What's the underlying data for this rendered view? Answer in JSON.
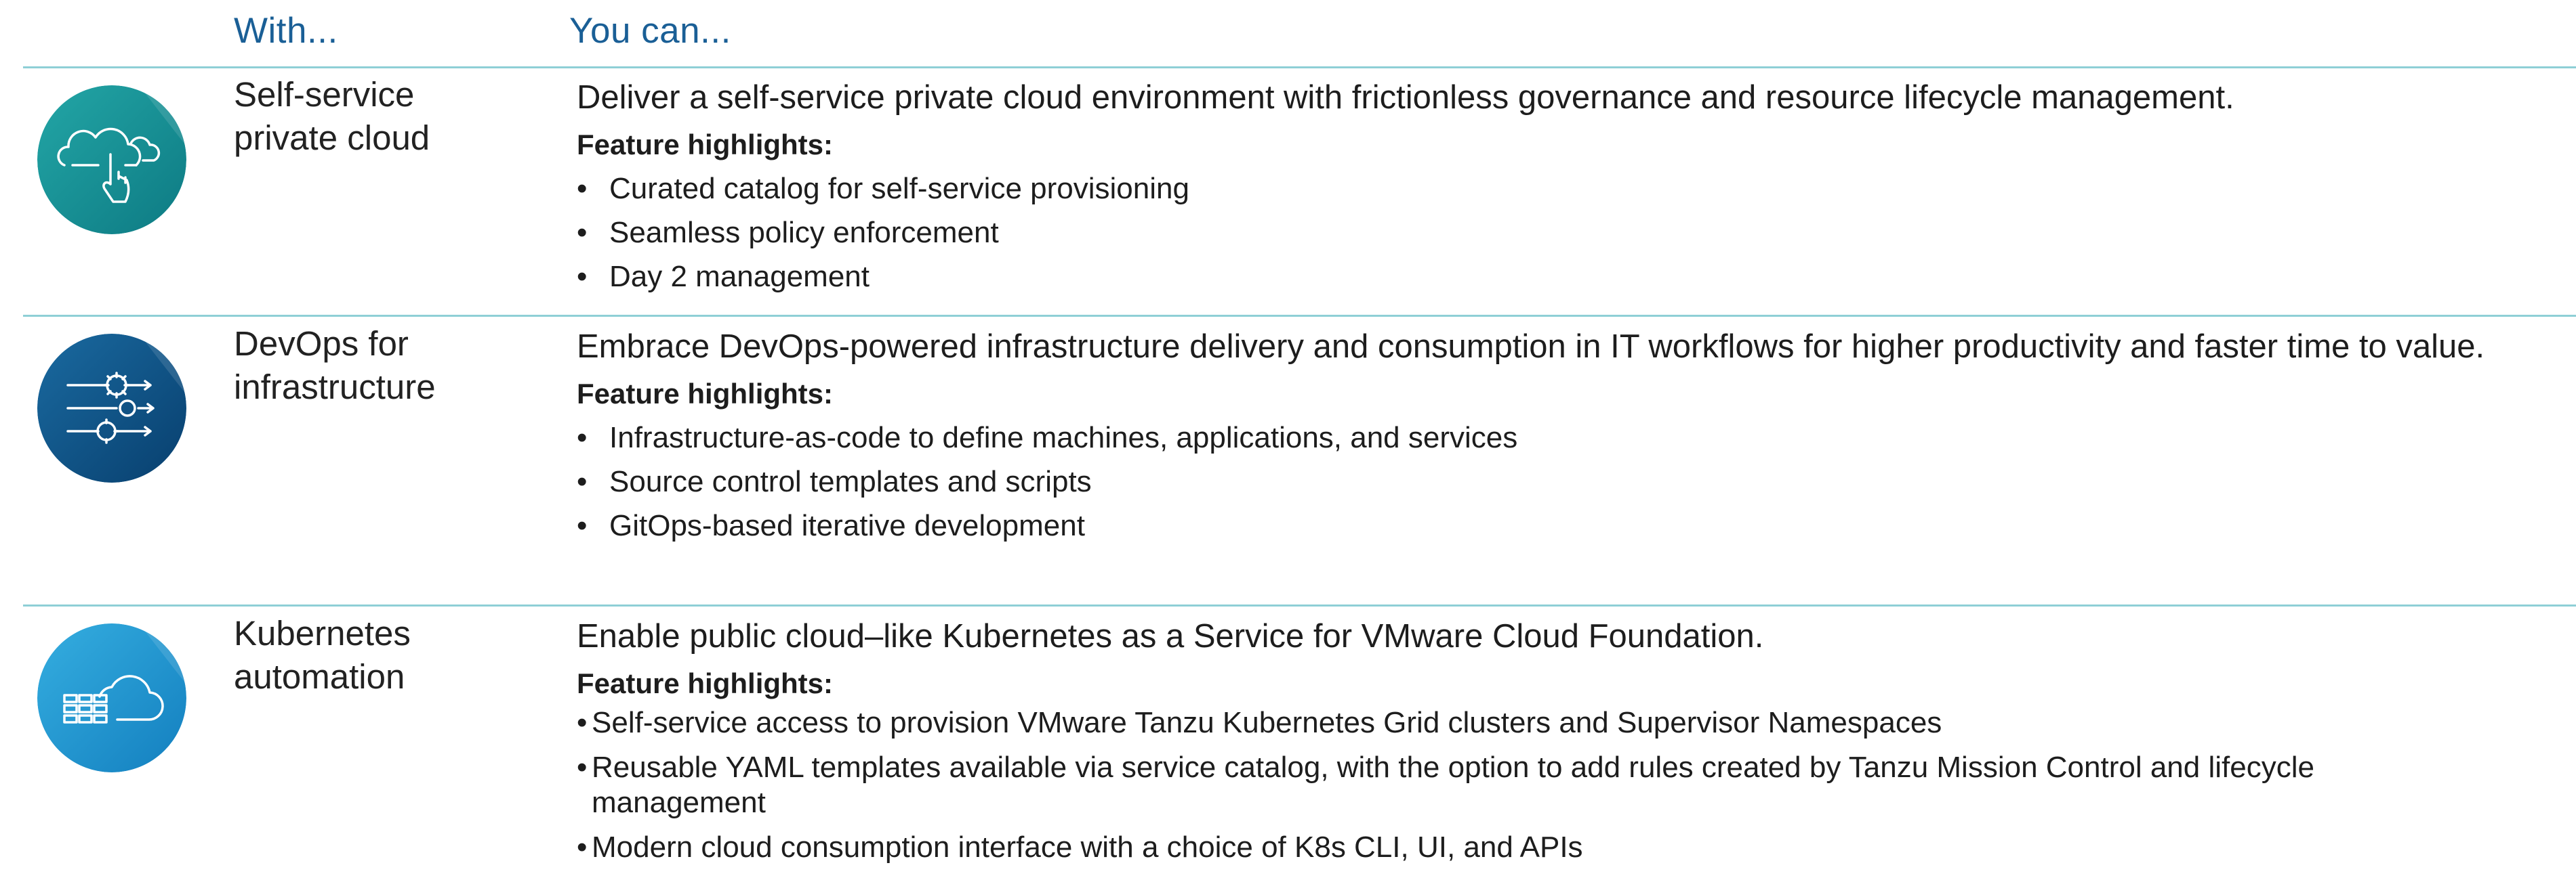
{
  "header": {
    "with_label": "With...",
    "can_label": "You can..."
  },
  "rows": [
    {
      "icon": "cloud-touch-icon",
      "with_line1": "Self-service",
      "with_line2": "private cloud",
      "description": "Deliver a self-service private cloud environment with frictionless governance and resource lifecycle management.",
      "highlights_label": "Feature highlights:",
      "bullets": [
        "Curated catalog for self-service provisioning",
        "Seamless policy enforcement",
        "Day 2 management"
      ]
    },
    {
      "icon": "gears-flow-icon",
      "with_line1": "DevOps for",
      "with_line2": "infrastructure",
      "description": "Embrace DevOps-powered infrastructure delivery and consumption in IT workflows for higher productivity and faster time to value.",
      "highlights_label": "Feature highlights:",
      "bullets": [
        "Infrastructure-as-code to define machines, applications, and services",
        "Source control templates and scripts",
        "GitOps-based iterative development"
      ]
    },
    {
      "icon": "cloud-containers-icon",
      "with_line1": "Kubernetes",
      "with_line2": "automation",
      "description": "Enable public cloud–like Kubernetes as a Service for VMware Cloud Foundation.",
      "highlights_label": "Feature highlights:",
      "bullets": [
        "Self-service access to provision VMware Tanzu Kubernetes Grid clusters and Supervisor Namespaces",
        "Reusable YAML templates available via service catalog, with the option to add rules created by Tanzu Mission Control and lifecycle management",
        "Modern cloud consumption interface with a choice of K8s CLI, UI, and APIs"
      ]
    }
  ],
  "bullet_char": "•",
  "colors": {
    "header_blue": "#1a5f96",
    "rule": "#8ecfd6",
    "icon1": "#13898f",
    "icon2": "#0c4f82",
    "icon3": "#1a93d1"
  }
}
